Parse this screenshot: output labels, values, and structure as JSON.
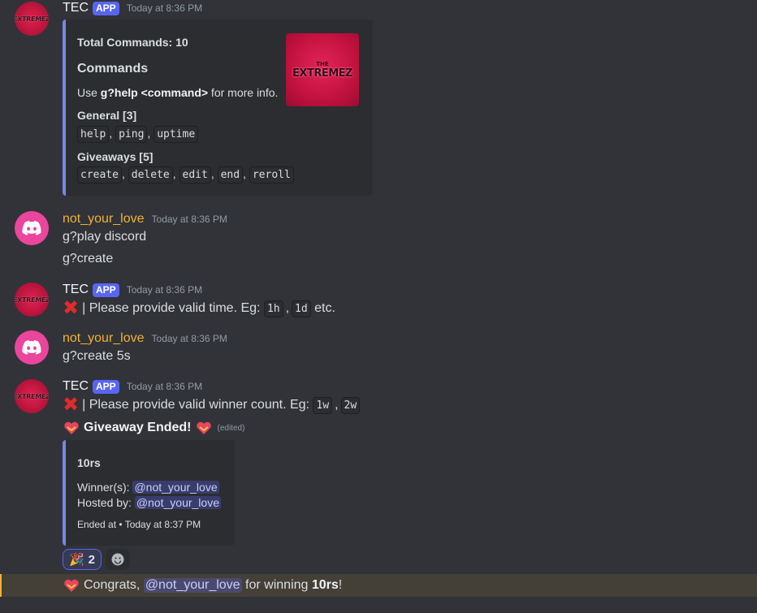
{
  "messages": {
    "m1": {
      "username": "TEC",
      "tag": "APP",
      "timestamp": "Today at 8:36 PM",
      "embed": {
        "total": "Total Commands: 10",
        "title": "Commands",
        "use_pre": "Use ",
        "use_cmd": "g?help <command>",
        "use_post": " for more info.",
        "general_title": "General [3]",
        "general_cmds": [
          "help",
          "ping",
          "uptime"
        ],
        "giveaways_title": "Giveaways [5]",
        "giveaway_cmds": [
          "create",
          "delete",
          "edit",
          "end",
          "reroll"
        ],
        "thumb_line1": "THE",
        "thumb_line2": "EXTREMEZ"
      }
    },
    "m2": {
      "username": "not_your_love",
      "timestamp": "Today at 8:36 PM",
      "line1": "g?play discord",
      "line2": "g?create"
    },
    "m3": {
      "username": "TEC",
      "tag": "APP",
      "timestamp": "Today at 8:36 PM",
      "text": "| Please provide valid time. Eg: ",
      "code1": "1h",
      "sep": ",",
      "code2": "1d",
      "tail": " etc."
    },
    "m4": {
      "username": "not_your_love",
      "timestamp": "Today at 8:36 PM",
      "line1": "g?create 5s"
    },
    "m5": {
      "username": "TEC",
      "tag": "APP",
      "timestamp": "Today at 8:36 PM",
      "text": "| Please provide valid winner count. Eg: ",
      "code1": "1w",
      "sep": ",",
      "code2": "2w",
      "giveaway_title": "Giveaway Ended!",
      "edited": "(edited)",
      "embed": {
        "prize": "10rs",
        "winners_label": "Winner(s): ",
        "winner": "@not_your_love",
        "hosted_label": "Hosted by: ",
        "host": "@not_your_love",
        "footer": "Ended at • Today at 8:37 PM"
      },
      "reaction_count": "2",
      "congrats_pre": "Congrats, ",
      "congrats_mention": "@not_your_love",
      "congrats_mid": " for winning ",
      "congrats_prize": "10rs",
      "congrats_end": "!"
    }
  },
  "colors": {
    "bg": "#313338",
    "embed_bg": "#2b2d31",
    "accent": "#7d83e4",
    "username_user": "#f0b232",
    "app_tag": "#5865f2"
  },
  "icons": {
    "user_avatar": "discord-logo-icon",
    "bot_avatar": "extremez-logo",
    "error": "cross-mark-icon",
    "heart": "heart-with-ribbon-icon",
    "party": "party-popper-icon",
    "add_reaction": "smile-icon"
  }
}
